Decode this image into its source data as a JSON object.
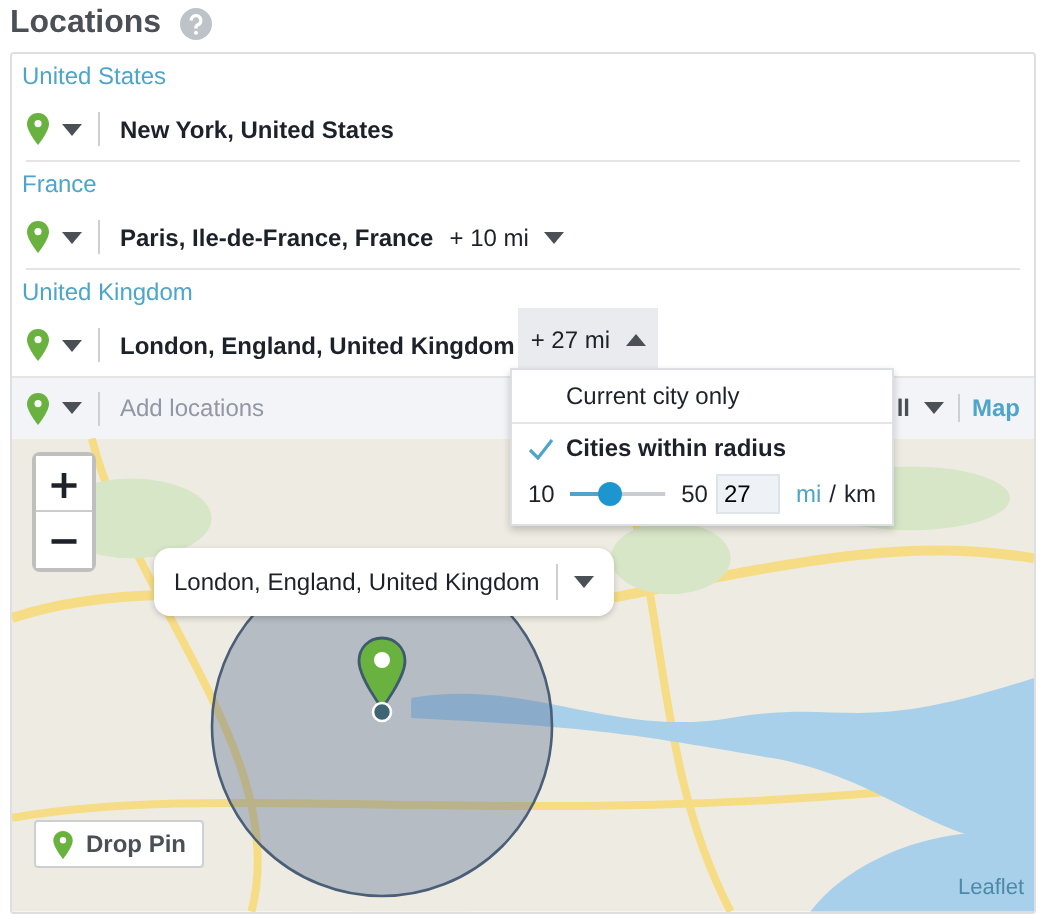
{
  "header": {
    "title": "Locations"
  },
  "locations": [
    {
      "country": "United States",
      "name": "New York, United States"
    },
    {
      "country": "France",
      "name": "Paris, Ile-de-France, France",
      "radius": "+ 10 mi",
      "radius_open": false
    },
    {
      "country": "United Kingdom",
      "name": "London, England, United Kingdom",
      "radius": "+ 27 mi",
      "radius_open": true
    }
  ],
  "add_row": {
    "placeholder": "Add locations",
    "filter_label": "ll",
    "map_link": "Map"
  },
  "radius_menu": {
    "options": [
      {
        "label": "Current city only",
        "selected": false
      },
      {
        "label": "Cities within radius",
        "selected": true
      }
    ],
    "min": "10",
    "max": "50",
    "value": "27",
    "level": 0.425,
    "units": [
      {
        "label": "mi",
        "selected": true
      },
      {
        "label": "km",
        "selected": false
      }
    ],
    "separator": "/"
  },
  "map": {
    "zoom_in": "+",
    "zoom_out": "−",
    "popup": "London, England, United Kingdom",
    "drop_pin": "Drop Pin",
    "attribution": "Leaflet"
  }
}
